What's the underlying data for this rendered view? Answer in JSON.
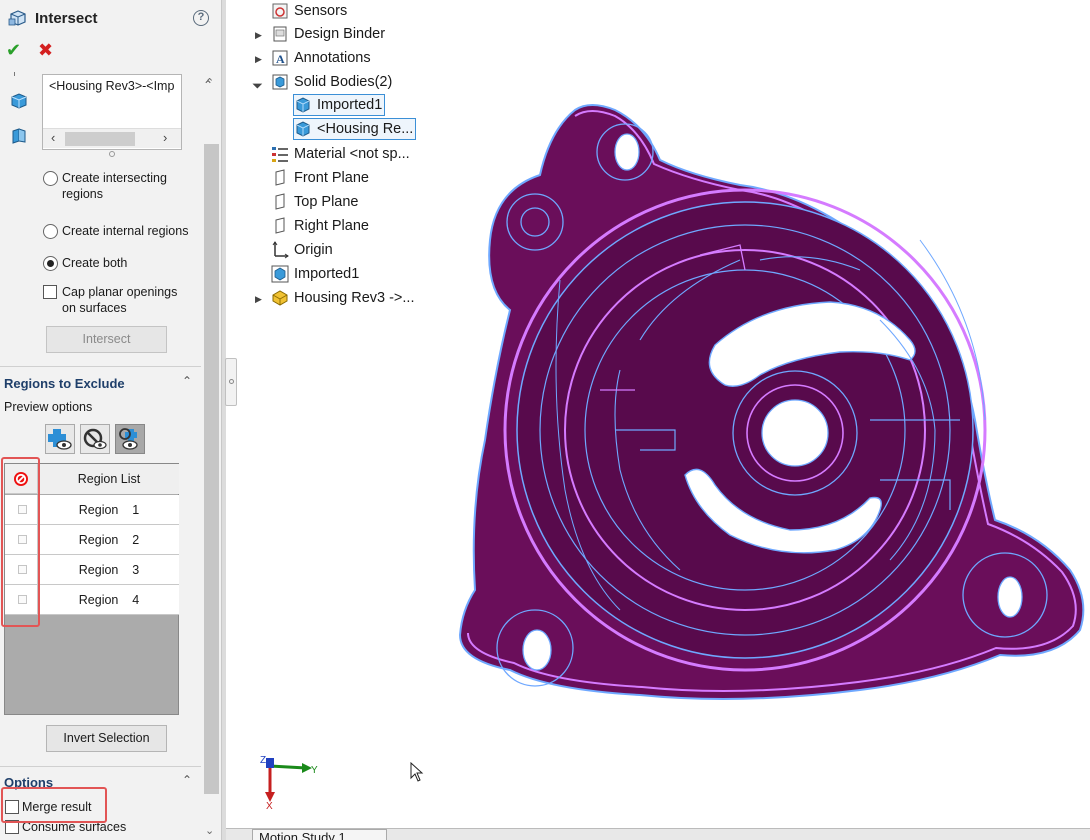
{
  "property_manager": {
    "title": "Intersect",
    "help_icon": "?",
    "ok_icon": "✔",
    "cancel_icon": "✖",
    "selection_value": "<Housing Rev3>-<Imp",
    "options": {
      "create_intersecting": "Create intersecting regions",
      "create_intersecting_line1": "Create intersecting",
      "create_intersecting_line2": "regions",
      "create_internal": "Create internal regions",
      "create_both": "Create both",
      "cap_line1": "Cap planar openings",
      "cap_line2": "on surfaces",
      "selected": "Create both"
    },
    "intersect_button": "Intersect",
    "regions_section": {
      "title": "Regions to Exclude",
      "preview_label": "Preview options",
      "table_header": "Region List",
      "rows": [
        "Region    1",
        "Region    2",
        "Region    3",
        "Region    4"
      ],
      "invert_button": "Invert Selection"
    },
    "options_section": {
      "title": "Options",
      "merge_result": "Merge result",
      "consume_surfaces": "Consume surfaces"
    },
    "colors": {
      "accent_highlight": "#e25555",
      "section_title": "#1f3f6a"
    }
  },
  "feature_tree": {
    "items": [
      {
        "label": "Sensors",
        "icon": "sensor-icon"
      },
      {
        "label": "Design Binder",
        "icon": "binder-icon"
      },
      {
        "label": "Annotations",
        "icon": "annotation-icon"
      },
      {
        "label": "Solid Bodies(2)",
        "icon": "solid-bodies-icon"
      },
      {
        "label": "Imported1",
        "icon": "body-icon"
      },
      {
        "label": "<Housing Re...",
        "icon": "body-icon"
      },
      {
        "label": "Material <not sp...",
        "icon": "material-icon"
      },
      {
        "label": "Front Plane",
        "icon": "plane-icon"
      },
      {
        "label": "Top Plane",
        "icon": "plane-icon"
      },
      {
        "label": "Right Plane",
        "icon": "plane-icon"
      },
      {
        "label": "Origin",
        "icon": "origin-icon"
      },
      {
        "label": "Imported1",
        "icon": "imported-feature-icon"
      },
      {
        "label": "Housing Rev3 ->...",
        "icon": "part-icon"
      }
    ]
  },
  "triad": {
    "z": "Z",
    "y": "Y",
    "x": "X"
  },
  "bottom_tabs": {
    "motion_study": "Motion Study 1"
  },
  "model": {
    "body_color": "#6a0e5a",
    "edge_color": "#6fa8ff",
    "highlight_edge": "#d57bff"
  }
}
